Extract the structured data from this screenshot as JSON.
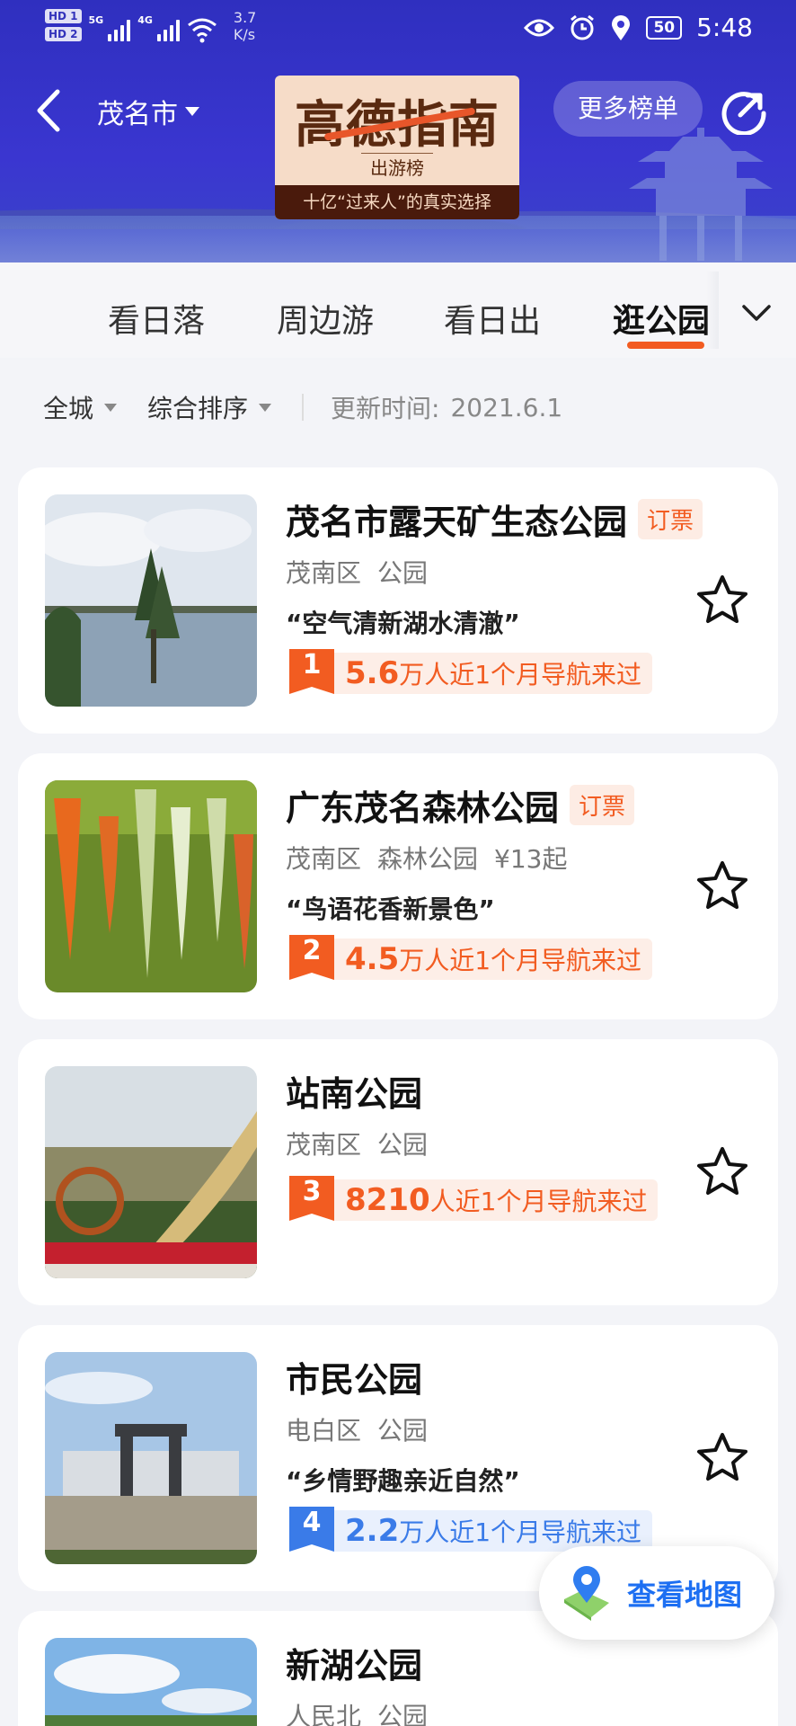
{
  "status_bar": {
    "hd1": "HD 1",
    "hd2": "HD 2",
    "net1": "5G",
    "net2": "4G",
    "speed_value": "3.7",
    "speed_unit": "K/s",
    "battery": "50",
    "time": "5:48"
  },
  "header": {
    "city": "茂名市",
    "logo_title": "高德指南",
    "logo_subtitle": "出游榜",
    "logo_tagline": "十亿“过来人”的真实选择",
    "more_label": "更多榜单"
  },
  "tabs": [
    {
      "label": "看日落"
    },
    {
      "label": "周边游"
    },
    {
      "label": "看日出"
    },
    {
      "label": "逛公园",
      "active": true
    }
  ],
  "filters": {
    "area": "全城",
    "sort": "综合排序",
    "update_label": "更新时间:",
    "update_date": "2021.6.1"
  },
  "list": [
    {
      "name": "茂名市露天矿生态公园",
      "ticket": "订票",
      "district": "茂南区",
      "category": "公园",
      "price": "",
      "quote": "“空气清新湖水清澈”",
      "rank": "1",
      "visitors": "5.6",
      "visitors_text": "万人近1个月导航来过"
    },
    {
      "name": "广东茂名森林公园",
      "ticket": "订票",
      "district": "茂南区",
      "category": "森林公园",
      "price": "¥13起",
      "quote": "“鸟语花香新景色”",
      "rank": "2",
      "visitors": "4.5",
      "visitors_text": "万人近1个月导航来过"
    },
    {
      "name": "站南公园",
      "ticket": "",
      "district": "茂南区",
      "category": "公园",
      "price": "",
      "quote": "",
      "rank": "3",
      "visitors": "8210",
      "visitors_text": "人近1个月导航来过"
    },
    {
      "name": "市民公园",
      "ticket": "",
      "district": "电白区",
      "category": "公园",
      "price": "",
      "quote": "“乡情野趣亲近自然”",
      "rank": "4",
      "visitors": "2.2",
      "visitors_text": "万人近1个月导航来过"
    },
    {
      "name": "新湖公园",
      "ticket": "",
      "district": "人民北",
      "category": "公园",
      "price": "",
      "quote": "",
      "rank": "",
      "visitors": "",
      "visitors_text": ""
    }
  ],
  "map_button": {
    "label": "查看地图"
  },
  "colors": {
    "header_bg": "#3a36d0",
    "accent_orange": "#f25c21",
    "accent_blue": "#3a7be8",
    "map_blue": "#1d6ff2"
  }
}
